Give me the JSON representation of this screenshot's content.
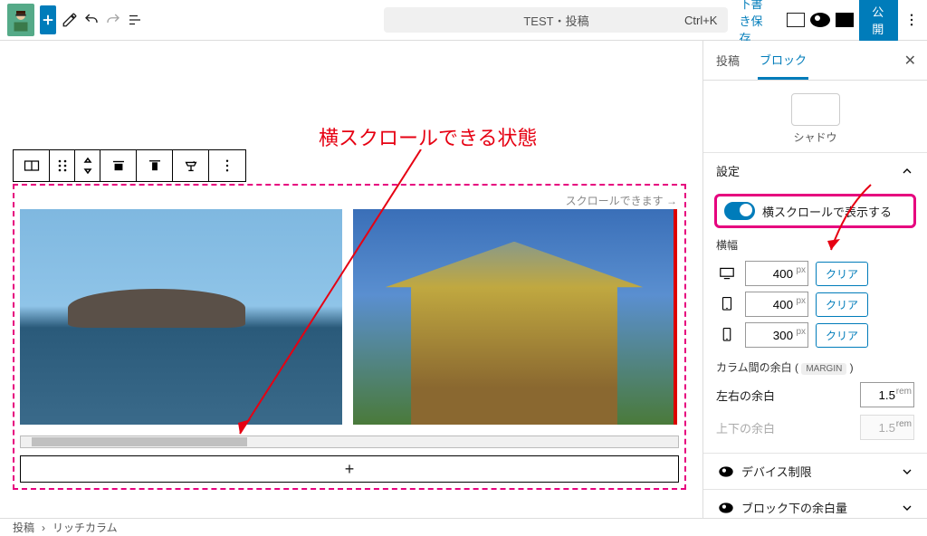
{
  "topbar": {
    "title": "TEST・投稿",
    "shortcut": "Ctrl+K",
    "save_draft": "下書き保存",
    "publish": "公開"
  },
  "annotation": "横スクロールできる状態",
  "gallery": {
    "hint": "スクロールできます →"
  },
  "sidebar": {
    "tabs": {
      "post": "投稿",
      "block": "ブロック"
    },
    "shadow_label": "シャドウ",
    "settings_header": "設定",
    "toggle_label": "横スクロールで表示する",
    "width_label": "横幅",
    "widths": [
      {
        "device": "desktop",
        "value": "400",
        "unit": "px",
        "clear": "クリア"
      },
      {
        "device": "tablet",
        "value": "400",
        "unit": "px",
        "clear": "クリア"
      },
      {
        "device": "mobile",
        "value": "300",
        "unit": "px",
        "clear": "クリア"
      }
    ],
    "column_gap_label": "カラム間の余白",
    "column_gap_chip": "MARGIN",
    "lr_label": "左右の余白",
    "lr_value": "1.5",
    "lr_unit": "rem",
    "tb_label": "上下の余白",
    "tb_value": "1.5",
    "tb_unit": "rem",
    "device_limit": "デバイス制限",
    "bottom_margin": "ブロック下の余白量"
  },
  "breadcrumb": {
    "root": "投稿",
    "current": "リッチカラム"
  }
}
